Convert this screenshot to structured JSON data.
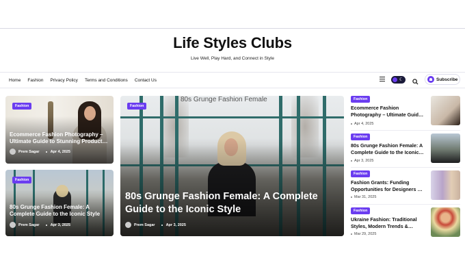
{
  "site": {
    "title": "Life Styles Clubs",
    "tagline": "Live Well, Play Hard, and Connect in Style"
  },
  "nav": {
    "items": [
      "Home",
      "Fashion",
      "Privacy Policy",
      "Terms and Conditions",
      "Contact Us"
    ],
    "subscribe_label": "Subscribe"
  },
  "cards": {
    "card1": {
      "category": "Fashion",
      "title": "Ecommerce Fashion Photography – Ultimate Guide to Stunning Product…",
      "author": "Prem Sagar",
      "date": "Apr 4, 2025"
    },
    "card2": {
      "category": "Fashion",
      "title": "80s Grunge Fashion Female: A Complete Guide to the Iconic Style",
      "author": "Prem Sagar",
      "date": "Apr 3, 2025"
    },
    "hero": {
      "category": "Fashion",
      "title": "80s Grunge Fashion Female: A Complete Guide to the Iconic Style",
      "author": "Prem Sagar",
      "date": "Apr 3, 2025",
      "image_text": "80s Grunge Fashion Female"
    }
  },
  "list": [
    {
      "category": "Fashion",
      "title": "Ecommerce Fashion Photography – Ultimate Guid…",
      "date": "Apr 4, 2025"
    },
    {
      "category": "Fashion",
      "title": "80s Grunge Fashion Female: A Complete Guide to the Iconic…",
      "date": "Apr 3, 2025"
    },
    {
      "category": "Fashion",
      "title": "Fashion Grants: Funding Opportunities for Designers …",
      "date": "Mar 31, 2025"
    },
    {
      "category": "Fashion",
      "title": "Ukraine Fashion: Traditional Styles, Modern Trends &…",
      "date": "Mar 29, 2025"
    }
  ],
  "colors": {
    "accent": "#6a3cf0",
    "toggle_bg": "#1a1a3a"
  },
  "icons": [
    "hamburger-menu-icon",
    "moon-icon",
    "search-icon",
    "bell-icon",
    "avatar-icon"
  ]
}
